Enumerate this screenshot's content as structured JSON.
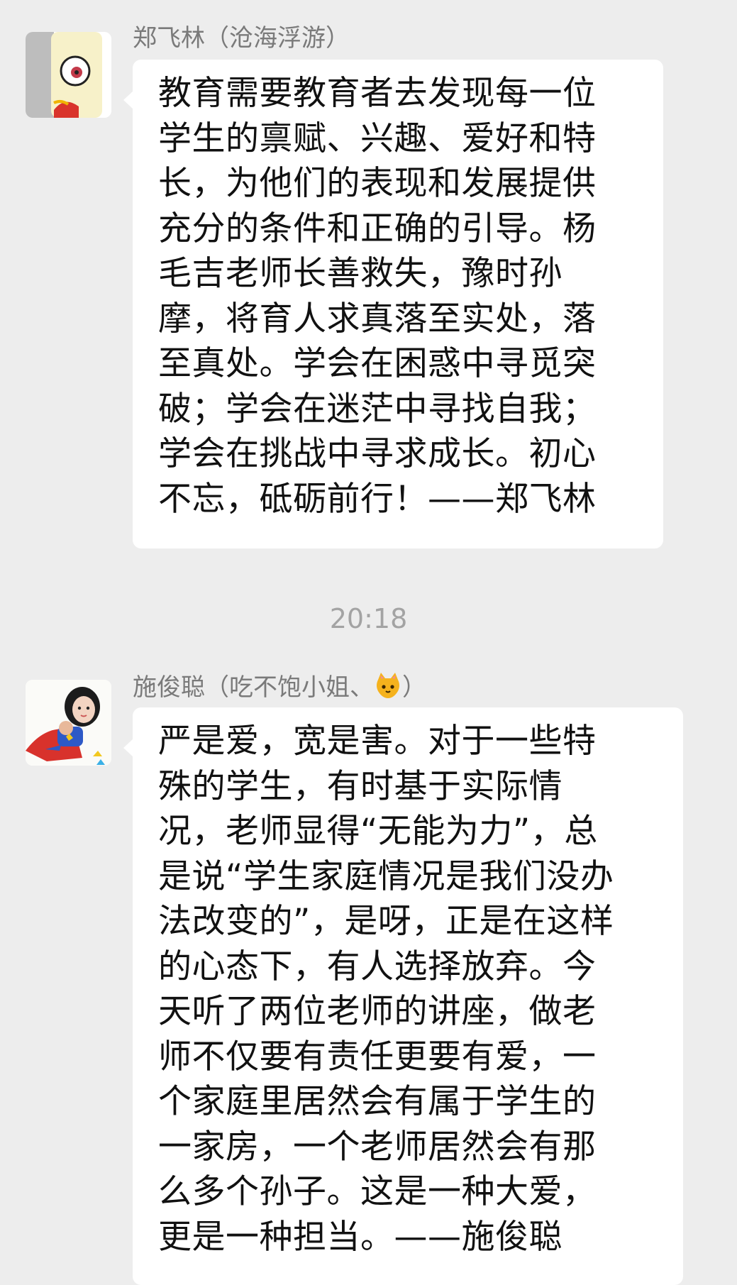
{
  "messages": [
    {
      "sender": "郑飞林（沧海浮游）",
      "text": "教育需要教育者去发现每一位\n学生的禀赋、兴趣、爱好和特\n长，为他们的表现和发展提供\n充分的条件和正确的引导。杨\n毛吉老师长善救失，豫时孙\n摩，将育人求真落至实处，落\n至真处。学会在困惑中寻觅突\n破；学会在迷茫中寻找自我；\n学会在挑战中寻求成长。初心\n不忘，砥砺前行！——郑飞林",
      "avatar_icon": "cartoon-avatar-icon"
    },
    {
      "sender": "施俊聪（吃不饱小姐、",
      "sender_suffix": "）",
      "sender_emoji_icon": "cat-emoji-icon",
      "text": "严是爱，宽是害。对于一些特\n殊的学生，有时基于实际情\n况，老师显得“无能为力”，总\n是说“学生家庭情况是我们没办\n法改变的”，是呀，正是在这样\n的心态下，有人选择放弃。今\n天听了两位老师的讲座，做老\n师不仅要有责任更要有爱，一\n个家庭里居然会有属于学生的\n一家房，一个老师居然会有那\n么多个孙子。这是一种大爱，\n更是一种担当。——施俊聪",
      "avatar_icon": "superhero-photo-avatar-icon"
    }
  ],
  "timestamp": "20:18",
  "colors": {
    "background": "#ededed",
    "bubble": "#ffffff",
    "text": "#111111",
    "sender": "#7a7a7a",
    "timestamp": "#a3a3a3"
  }
}
